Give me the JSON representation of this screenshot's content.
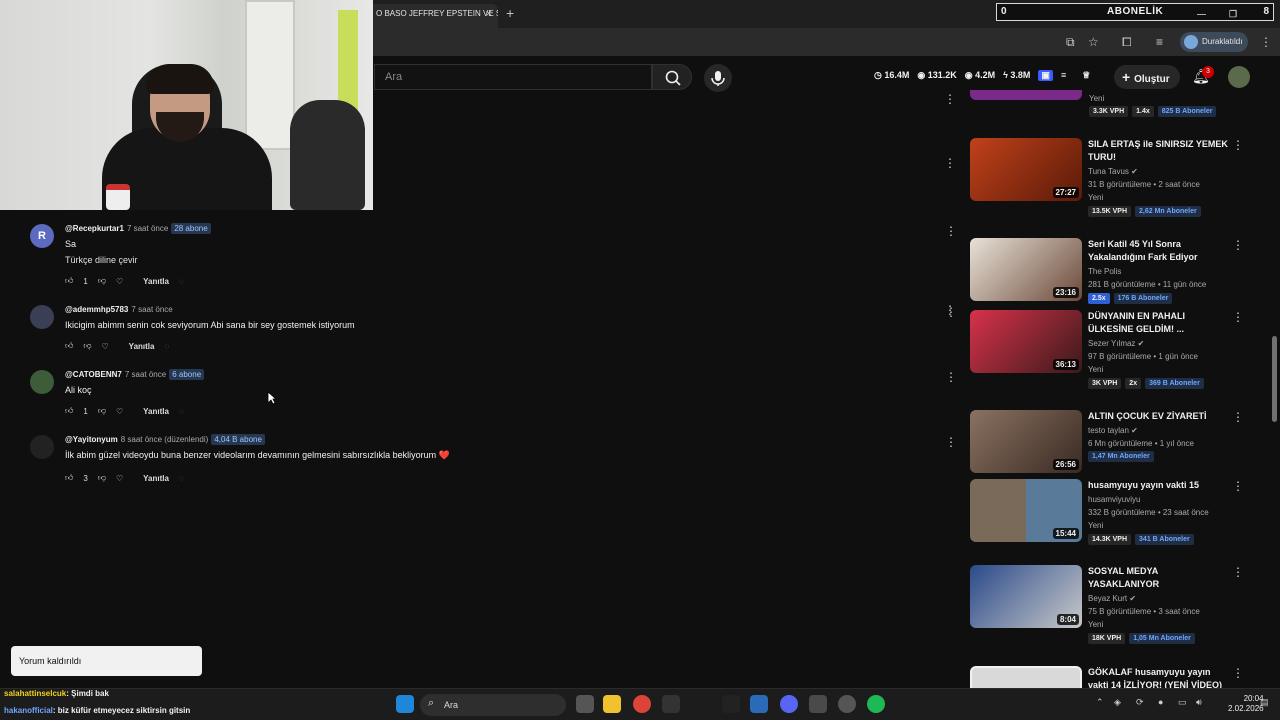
{
  "browser": {
    "tab_title": "O BASO JEFFREY EPSTEIN VE S",
    "tab_close": "×",
    "new_tab": "+",
    "subscriber_widget": {
      "count": "0",
      "label": "ABONELİK",
      "right": "8"
    },
    "profile_label": "Duraklatıldı"
  },
  "header": {
    "search_placeholder": "Ara",
    "stats": [
      {
        "icon": "clock-icon",
        "value": "16.4M"
      },
      {
        "icon": "eye-icon",
        "value": "131.2K"
      },
      {
        "icon": "eye-icon",
        "value": "4.2M"
      },
      {
        "icon": "bolt-icon",
        "value": "3.8M"
      }
    ],
    "create_label": "Oluştur",
    "notification_count": "3"
  },
  "comments": [
    {
      "avatar_letter": "R",
      "avatar_color": "#5c6bc0",
      "user": "@Recepkurtar1",
      "time": "7 saat önce",
      "badge": "28 abone",
      "lines": [
        "Sa",
        "Türkçe diline çevir"
      ],
      "likes": "1",
      "reply": "Yanıtla"
    },
    {
      "avatar_letter": "",
      "avatar_color": "#3a3f55",
      "user": "@ademmhp5783",
      "time": "7 saat önce",
      "badge": "",
      "lines": [
        "Ikicigim abimm senin cok seviyorum Abi sana bir sey gostemek istiyorum"
      ],
      "likes": "",
      "reply": "Yanıtla"
    },
    {
      "avatar_letter": "",
      "avatar_color": "#3d5c3a",
      "user": "@CATOBENN7",
      "time": "7 saat önce",
      "badge": "6 abone",
      "lines": [
        "Ali koç"
      ],
      "likes": "1",
      "reply": "Yanıtla"
    },
    {
      "avatar_letter": "",
      "avatar_color": "#222222",
      "user": "@Yayitonyum",
      "time": "8 saat önce (düzenlendi)",
      "badge": "4,04 B abone",
      "lines": [
        "İlk abim güzel videoydu buna benzer videolarım devamının gelmesini sabırsızlıkla bekliyorum ❤️"
      ],
      "likes": "3",
      "reply": "Yanıtla"
    }
  ],
  "sidebar": {
    "top_partial": {
      "tag1": "Yeni",
      "tags": [
        "3.3K VPH",
        "1.4x",
        "825 B Aboneler"
      ]
    },
    "items": [
      {
        "title": "SILA ERTAŞ ile SINIRSIZ YEMEK TURU!",
        "channel": "Tuna Tavus",
        "meta": "31 B görüntüleme • 2 saat önce",
        "new": "Yeni",
        "tags": [
          "13.5K VPH"
        ],
        "subs": "2,62 Mn Aboneler",
        "duration": "27:27",
        "thumb": "#8a2b12"
      },
      {
        "title": "Seri Katil 45 Yıl Sonra Yakalandığını Fark Ediyor",
        "channel": "The Polis",
        "meta": "281 B görüntüleme • 11 gün önce",
        "new": "",
        "tags": [
          "2.5x"
        ],
        "subs": "176 B Aboneler",
        "duration": "23:16",
        "thumb": "#5b4a3e"
      },
      {
        "title": "DÜNYANIN EN PAHALI ÜLKESİNE GELDİM! ...",
        "channel": "Sezer Yılmaz",
        "meta": "97 B görüntüleme • 1 gün önce",
        "new": "Yeni",
        "tags": [
          "3K VPH",
          "2x"
        ],
        "subs": "369 B Aboneler",
        "duration": "36:13",
        "thumb": "#b42a3a"
      },
      {
        "title": "ALTIN ÇOCUK EV ZİYARETİ",
        "channel": "testo taylan",
        "meta": "6 Mn görüntüleme • 1 yıl önce",
        "new": "",
        "tags": [],
        "subs": "1,47 Mn Aboneler",
        "duration": "26:56",
        "thumb": "#6b5548"
      },
      {
        "title": "husamyuyu yayın vakti 15",
        "channel": "husamviyuviyu",
        "meta": "332 B görüntüleme • 23 saat önce",
        "new": "Yeni",
        "tags": [
          "14.3K VPH"
        ],
        "subs": "341 B Aboneler",
        "duration": "15:44",
        "thumb": "#4a5a6a"
      },
      {
        "title": "SOSYAL MEDYA YASAKLANIYOR",
        "channel": "Beyaz Kurt",
        "meta": "75 B görüntüleme • 3 saat önce",
        "new": "Yeni",
        "tags": [
          "18K VPH"
        ],
        "subs": "1,05 Mn Aboneler",
        "duration": "8:04",
        "thumb": "#1d3a6a"
      },
      {
        "title": "GÖKALAF husamyuyu yayın vakti 14 İZLİYOR! (YENİ VİDEO)",
        "channel": "",
        "meta": "",
        "new": "",
        "tags": [],
        "subs": "",
        "duration": "",
        "thumb": "#d9d9d9"
      }
    ]
  },
  "toast": "Yorum kaldırıldı",
  "chat": [
    {
      "user": "salahattinselcuk",
      "text": ": Şimdi bak"
    },
    {
      "user": "hakanofficial",
      "text": ": biz küfür etmeyecez siktirsin gitsin"
    }
  ],
  "taskbar": {
    "search": "Ara",
    "time": "20:04",
    "date": "2.02.2026"
  }
}
